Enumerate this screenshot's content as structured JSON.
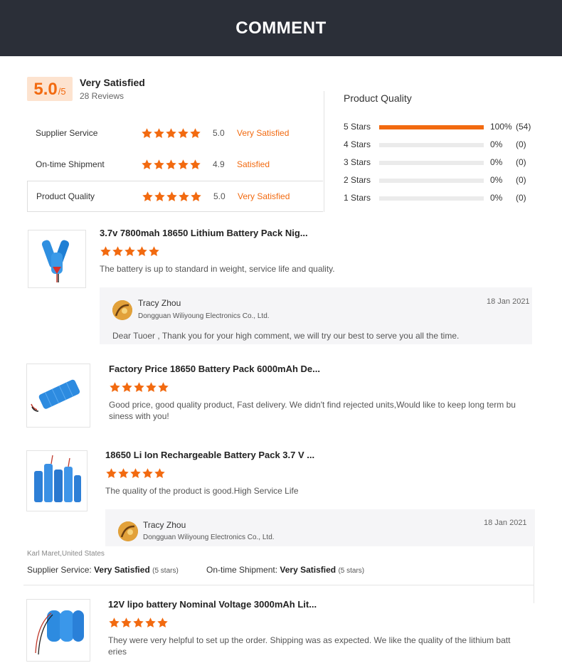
{
  "header": {
    "title": "COMMENT"
  },
  "summary": {
    "score": "5.0",
    "score_max": "/5",
    "rating_text": "Very Satisfied",
    "review_count": "28 Reviews",
    "metrics": [
      {
        "label": "Supplier Service",
        "score": "5.0",
        "text": "Very Satisfied",
        "stars": 5
      },
      {
        "label": "On-time Shipment",
        "score": "4.9",
        "text": "Satisfied",
        "stars": 5
      },
      {
        "label": "Product Quality",
        "score": "5.0",
        "text": "Very Satisfied",
        "stars": 5
      }
    ]
  },
  "product_quality": {
    "title": "Product Quality",
    "rows": [
      {
        "label": "5 Stars",
        "percent_value": 100,
        "percent": "100%",
        "count": "(54)"
      },
      {
        "label": "4 Stars",
        "percent_value": 0,
        "percent": "0%",
        "count": "(0)"
      },
      {
        "label": "3 Stars",
        "percent_value": 0,
        "percent": "0%",
        "count": "(0)"
      },
      {
        "label": "2 Stars",
        "percent_value": 0,
        "percent": "0%",
        "count": "(0)"
      },
      {
        "label": "1 Stars",
        "percent_value": 0,
        "percent": "0%",
        "count": "(0)"
      }
    ]
  },
  "reviews": [
    {
      "product": "3.7v 7800mah 18650 Lithium Battery Pack Nig...",
      "stars": 5,
      "text": "The battery is up to standard in weight, service life and quality.",
      "reply": {
        "name": "Tracy Zhou",
        "company": "Dongguan Wiliyoung Electronics Co., Ltd.",
        "date": "18 Jan 2021",
        "text": "Dear Tuoer , Thank you for your high comment, we will try our best to serve you all the time."
      }
    },
    {
      "product": "Factory Price 18650 Battery Pack 6000mAh De...",
      "stars": 5,
      "text_line1": "Good price, good quality product, Fast delivery. We didn't find rejected units,Would like to keep long term bu",
      "text_line2": "siness with you!"
    },
    {
      "product": "18650 Li Ion Rechargeable Battery Pack 3.7 V ...",
      "stars": 5,
      "text": "The quality of the product is good.High Service Life",
      "reply": {
        "name": "Tracy Zhou",
        "company": "Dongguan Wiliyoung Electronics Co., Ltd.",
        "date": "18 Jan 2021"
      }
    },
    {
      "product": "12V lipo battery Nominal Voltage 3000mAh Lit...",
      "stars": 5,
      "text_line1": "They were very helpful to set up the order.  Shipping was as expected.  We like the quality of the lithium batt",
      "text_line2": "eries"
    }
  ],
  "buyer": {
    "name": "Karl Maret,United States",
    "supplier_label": "Supplier Service:",
    "supplier_value": "Very Satisfied",
    "supplier_stars": "(5 stars)",
    "shipment_label": "On-time Shipment:",
    "shipment_value": "Very Satisfied",
    "shipment_stars": "(5 stars)"
  },
  "colors": {
    "accent": "#f26a10",
    "header_bg": "#2b2f38",
    "score_bg": "#fde3cf"
  }
}
